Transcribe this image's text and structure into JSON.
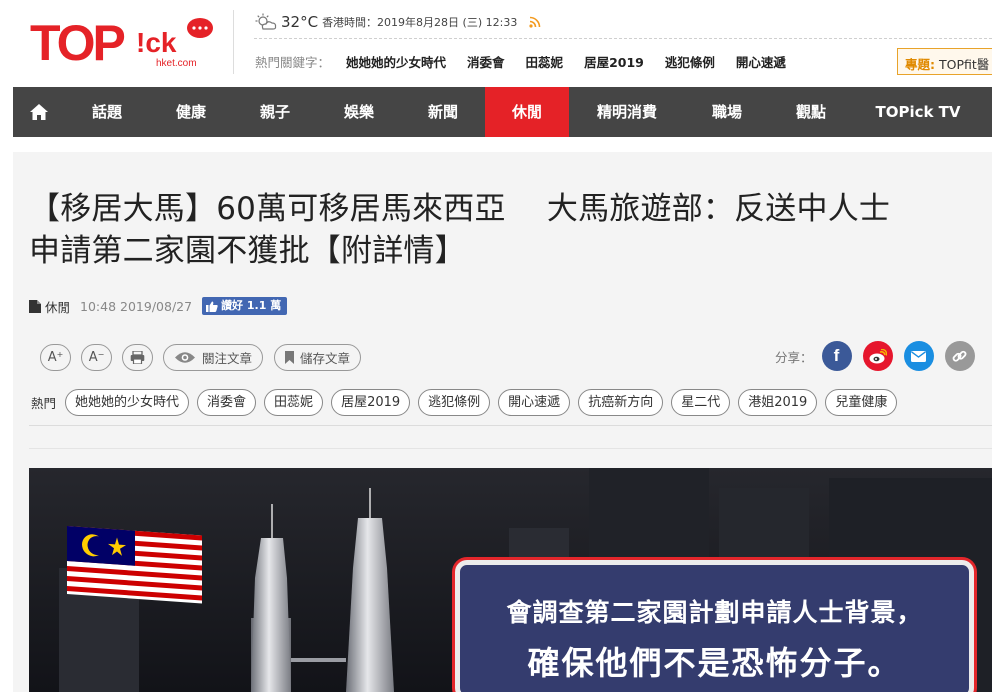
{
  "header": {
    "logo_text": "TOPick",
    "logo_sub": "hket.com",
    "weather": {
      "icon": "partly-cloudy-icon",
      "temperature": "32°C",
      "datetime": "香港時間：2019年8月28日 (三) 12:33"
    },
    "keywords_label": "熱門關鍵字：",
    "keywords": [
      "她她她的少女時代",
      "消委會",
      "田蕊妮",
      "居屋2019",
      "逃犯條例",
      "開心速遞"
    ],
    "topic_label": "專題:",
    "topic_text": "TOPfit醫"
  },
  "nav": {
    "home_icon": "home-icon",
    "items": [
      {
        "label": "話題",
        "active": false
      },
      {
        "label": "健康",
        "active": false
      },
      {
        "label": "親子",
        "active": false
      },
      {
        "label": "娛樂",
        "active": false
      },
      {
        "label": "新聞",
        "active": false
      },
      {
        "label": "休閒",
        "active": true
      },
      {
        "label": "精明消費",
        "active": false
      },
      {
        "label": "職場",
        "active": false
      },
      {
        "label": "觀點",
        "active": false
      },
      {
        "label": "TOPick TV",
        "active": false
      }
    ]
  },
  "article": {
    "title_line1": "【移居大馬】60萬可移居馬來西亞　 大馬旅遊部：反送中人士",
    "title_line2": "申請第二家園不獲批【附詳情】",
    "category": "休閒",
    "time": "10:48 2019/08/27",
    "like_label": "讚好 1.1 萬"
  },
  "tools": {
    "font_up": "A",
    "font_down": "A",
    "follow_label": "關注文章",
    "save_label": "儲存文章",
    "share_label": "分享："
  },
  "tags": {
    "label": "熱門",
    "items": [
      "她她她的少女時代",
      "消委會",
      "田蕊妮",
      "居屋2019",
      "逃犯條例",
      "開心速遞",
      "抗癌新方向",
      "星二代",
      "港姐2019",
      "兒童健康"
    ]
  },
  "hero": {
    "caption_line1": "會調查第二家園計劃申請人士背景，",
    "caption_line2": "確保他們不是恐怖分子。"
  },
  "colors": {
    "brand_red": "#e52227",
    "nav_bg": "#454545",
    "facebook": "#3b5998",
    "weibo": "#e6162d",
    "email": "#1a8ee1",
    "link": "#999999"
  }
}
